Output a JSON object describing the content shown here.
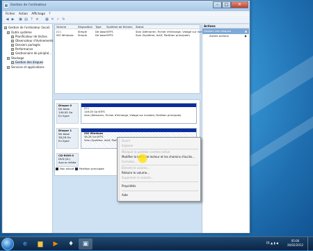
{
  "window": {
    "title": "Gestion de l'ordinateur"
  },
  "menu": [
    "Fichier",
    "Action",
    "Affichage",
    "?"
  ],
  "tree": [
    {
      "label": "Gestion de l'ordinateur (local)",
      "level": 0
    },
    {
      "label": "Outils système",
      "level": 1
    },
    {
      "label": "Planificateur de tâches",
      "level": 2
    },
    {
      "label": "Observateur d'événements",
      "level": 2
    },
    {
      "label": "Dossiers partagés",
      "level": 2
    },
    {
      "label": "Performance",
      "level": 2
    },
    {
      "label": "Gestionnaire de périphé...",
      "level": 2
    },
    {
      "label": "Stockage",
      "level": 1
    },
    {
      "label": "Gestion des disques",
      "level": 2
    },
    {
      "label": "Services et applications",
      "level": 1
    }
  ],
  "volume_table": {
    "columns": [
      "Volume",
      "Disposition",
      "Type",
      "Système de fichiers",
      "Statut"
    ],
    "rows": [
      [
        "(C:)",
        "Simple",
        "De base",
        "NTFS",
        "Sain (Démarrer, Fichier d'échange, Vidage sur inci..."
      ],
      [
        "ISO Windows",
        "Simple",
        "De base",
        "NTFS",
        "Sain (Système, Actif, Partition principale)"
      ]
    ]
  },
  "disks": [
    {
      "label": [
        "Disque 0",
        "De base",
        "149,05 Go",
        "En ligne"
      ],
      "partition": [
        "(C:)",
        "149,05 Go NTFS",
        "Sain (Démarrer, Fichier d'échange, Vidage sur incident, Partition principale)"
      ]
    },
    {
      "label": [
        "Disque 1",
        "De base",
        "38,28 Go",
        "En ligne"
      ],
      "partition": [
        "ISO Windows",
        "38,28 Go NTFS",
        "Sain (Système, Actif, Parti..."
      ]
    },
    {
      "label": [
        "CD-ROM 0",
        "DVD (D:)",
        "",
        "Aucun média"
      ],
      "partition": []
    }
  ],
  "legend": [
    {
      "label": "Non alloué",
      "color": "#111111"
    },
    {
      "label": "Partition principale",
      "color": "#0a2c9c"
    }
  ],
  "actions": {
    "header": "Actions",
    "selected": "Gestion des disques",
    "items": [
      "Autres actions"
    ]
  },
  "context_menu": [
    {
      "label": "Ouvrir",
      "enabled": false
    },
    {
      "label": "Explorer",
      "enabled": false
    },
    {
      "sep": true
    },
    {
      "label": "Marquer la partition comme active",
      "enabled": false
    },
    {
      "label": "Modifier la lettre de lecteur et les chemins d'accès...",
      "enabled": true
    },
    {
      "label": "Formater...",
      "enabled": false
    },
    {
      "sep": true
    },
    {
      "label": "Étendre le volume...",
      "enabled": false
    },
    {
      "label": "Réduire le volume...",
      "enabled": true
    },
    {
      "label": "Supprimer le volume...",
      "enabled": false
    },
    {
      "sep": true
    },
    {
      "label": "Propriétés",
      "enabled": true
    },
    {
      "sep": true
    },
    {
      "label": "Aide",
      "enabled": true
    }
  ],
  "taskbar": {
    "lang": "FR",
    "time": "05:06",
    "date": "26/02/2012"
  },
  "colors": {
    "accent": "#0a2c9c",
    "selection": "#7fa9d6"
  }
}
